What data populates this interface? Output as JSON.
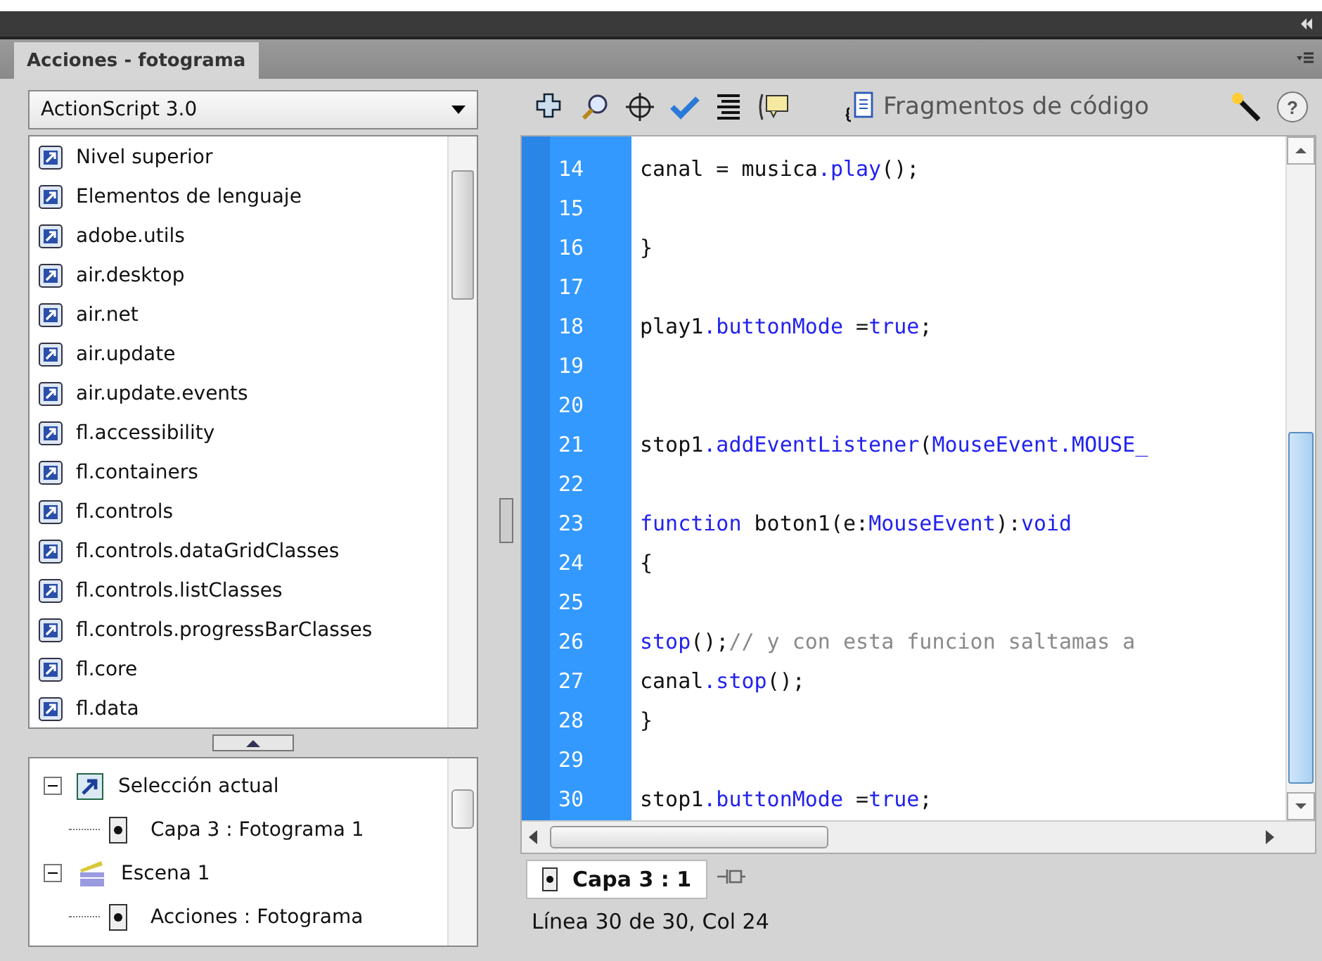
{
  "panel": {
    "title": "Acciones - fotograma"
  },
  "language_dropdown": {
    "value": "ActionScript 3.0"
  },
  "toolbox_items": [
    {
      "label": "Nivel superior"
    },
    {
      "label": "Elementos de lenguaje"
    },
    {
      "label": "adobe.utils"
    },
    {
      "label": "air.desktop"
    },
    {
      "label": "air.net"
    },
    {
      "label": "air.update"
    },
    {
      "label": "air.update.events"
    },
    {
      "label": "fl.accessibility"
    },
    {
      "label": "fl.containers"
    },
    {
      "label": "fl.controls"
    },
    {
      "label": "fl.controls.dataGridClasses"
    },
    {
      "label": "fl.controls.listClasses"
    },
    {
      "label": "fl.controls.progressBarClasses"
    },
    {
      "label": "fl.core"
    },
    {
      "label": "fl.data"
    }
  ],
  "script_tree": [
    {
      "label": "Selección actual",
      "kind": "selection",
      "expanded": true,
      "children": [
        {
          "label": "Capa 3 : Fotograma 1",
          "kind": "frame"
        }
      ]
    },
    {
      "label": "Escena 1",
      "kind": "scene",
      "expanded": true,
      "children": [
        {
          "label": "Acciones : Fotograma",
          "kind": "frame"
        }
      ]
    }
  ],
  "toolbar": {
    "snippets_label": "Fragmentos de código",
    "help_label": "?"
  },
  "code_lines": [
    {
      "number": "14",
      "tokens": [
        {
          "text": "canal = musica",
          "kind": "plain"
        },
        {
          "text": ".play",
          "kind": "keyword"
        },
        {
          "text": "();",
          "kind": "plain"
        }
      ]
    },
    {
      "number": "15"
    },
    {
      "number": "16",
      "tokens": [
        {
          "text": "}",
          "kind": "plain"
        }
      ]
    },
    {
      "number": "17"
    },
    {
      "number": "18",
      "tokens": [
        {
          "text": "play1",
          "kind": "plain"
        },
        {
          "text": ".buttonMode",
          "kind": "keyword"
        },
        {
          "text": " =",
          "kind": "plain"
        },
        {
          "text": "true",
          "kind": "keyword"
        },
        {
          "text": ";",
          "kind": "plain"
        }
      ]
    },
    {
      "number": "19"
    },
    {
      "number": "20"
    },
    {
      "number": "21",
      "tokens": [
        {
          "text": "stop1",
          "kind": "plain"
        },
        {
          "text": ".addEventListener",
          "kind": "keyword"
        },
        {
          "text": "(",
          "kind": "plain"
        },
        {
          "text": "MouseEvent.MOUSE_",
          "kind": "keyword"
        }
      ]
    },
    {
      "number": "22"
    },
    {
      "number": "23",
      "tokens": [
        {
          "text": "function",
          "kind": "keyword"
        },
        {
          "text": " boton1(e:",
          "kind": "plain"
        },
        {
          "text": "MouseEvent",
          "kind": "keyword"
        },
        {
          "text": "):",
          "kind": "plain"
        },
        {
          "text": "void",
          "kind": "keyword"
        }
      ]
    },
    {
      "number": "24",
      "tokens": [
        {
          "text": "{",
          "kind": "plain"
        }
      ]
    },
    {
      "number": "25"
    },
    {
      "number": "26",
      "tokens": [
        {
          "text": "stop",
          "kind": "keyword"
        },
        {
          "text": "();",
          "kind": "plain"
        },
        {
          "text": "// y con esta funcion saltamas a",
          "kind": "comment"
        }
      ]
    },
    {
      "number": "27",
      "tokens": [
        {
          "text": "canal",
          "kind": "plain"
        },
        {
          "text": ".stop",
          "kind": "keyword"
        },
        {
          "text": "();",
          "kind": "plain"
        }
      ]
    },
    {
      "number": "28",
      "tokens": [
        {
          "text": "}",
          "kind": "plain"
        }
      ]
    },
    {
      "number": "29"
    },
    {
      "number": "30",
      "tokens": [
        {
          "text": "stop1",
          "kind": "plain"
        },
        {
          "text": ".buttonMode",
          "kind": "keyword"
        },
        {
          "text": " =",
          "kind": "plain"
        },
        {
          "text": "true",
          "kind": "keyword"
        },
        {
          "text": ";",
          "kind": "plain"
        }
      ]
    }
  ],
  "script_tabs": [
    {
      "label": "Capa 3 : 1",
      "selected": true
    }
  ],
  "status_bar": {
    "text": "Línea 30 de 30, Col 24"
  }
}
